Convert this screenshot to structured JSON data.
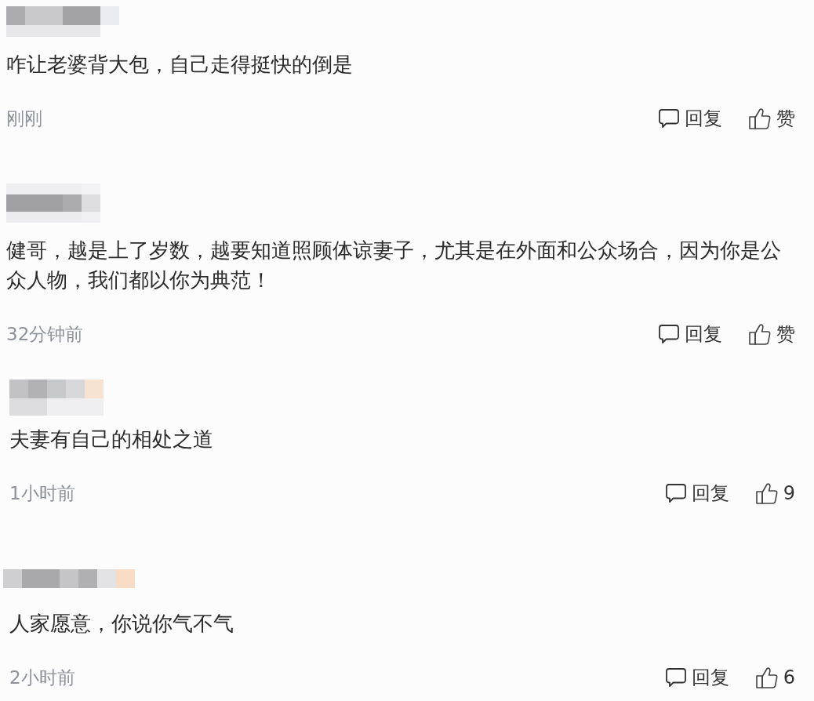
{
  "comments": [
    {
      "text": "咋让老婆背大包，自己走得挺快的倒是",
      "time": "刚刚",
      "reply_label": "回复",
      "like_label": "赞"
    },
    {
      "text": "健哥，越是上了岁数，越要知道照顾体谅妻子，尤其是在外面和公众场合，因为你是公众人物，我们都以你为典范！",
      "time": "32分钟前",
      "reply_label": "回复",
      "like_label": "赞"
    },
    {
      "text": "夫妻有自己的相处之道",
      "time": "1小时前",
      "reply_label": "回复",
      "like_label": "9"
    },
    {
      "text": "人家愿意，你说你气不气",
      "time": "2小时前",
      "reply_label": "回复",
      "like_label": "6"
    }
  ]
}
